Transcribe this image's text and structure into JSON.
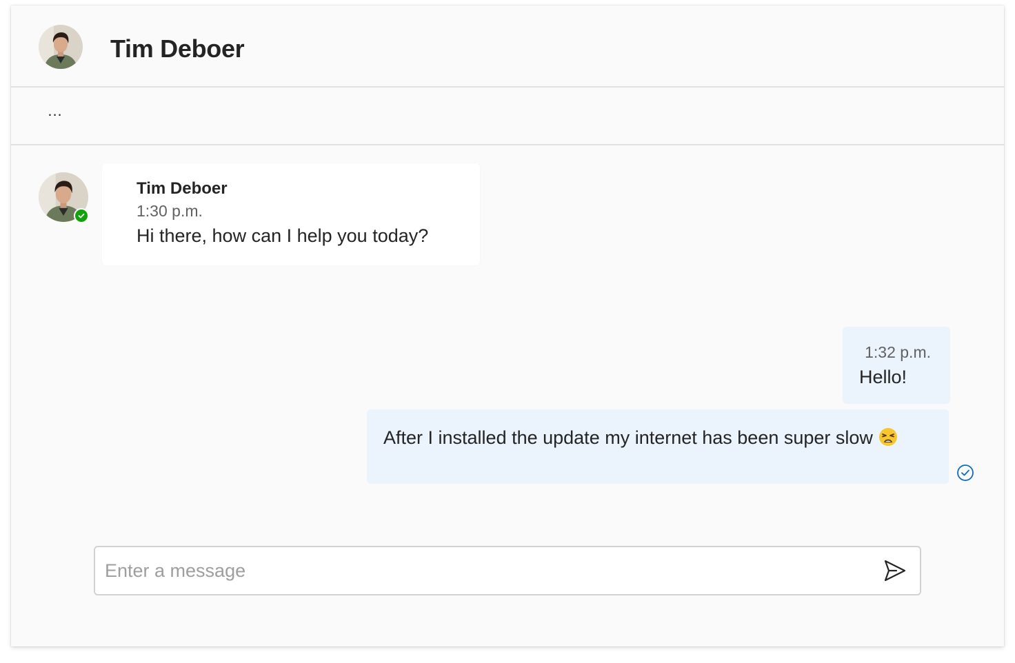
{
  "header": {
    "title": "Tim Deboer",
    "more_label": "..."
  },
  "messages": [
    {
      "direction": "incoming",
      "sender": "Tim Deboer",
      "time": "1:30 p.m.",
      "text": "Hi there, how can I help you today?",
      "presence": "available"
    },
    {
      "direction": "outgoing",
      "time": "1:32 p.m.",
      "text": "Hello!"
    },
    {
      "direction": "outgoing",
      "text": "After I installed the update my internet has been super slow",
      "emoji": "weary-face-icon",
      "status": "read"
    }
  ],
  "composer": {
    "placeholder": "Enter a message"
  },
  "colors": {
    "outgoing_bubble": "#ebf3fc",
    "presence_available": "#13a10e",
    "read_receipt": "#0f6cbd"
  }
}
